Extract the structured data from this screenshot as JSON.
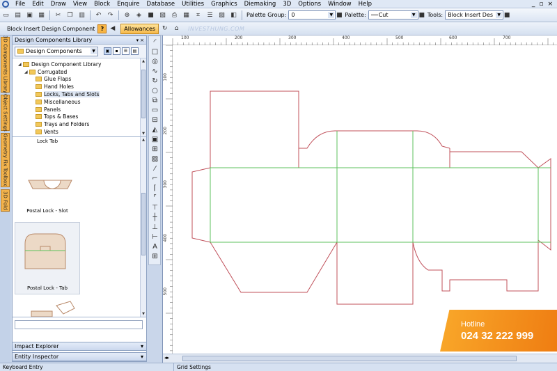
{
  "menu": [
    "File",
    "Edit",
    "Draw",
    "View",
    "Block",
    "Enquire",
    "Database",
    "Utilities",
    "Graphics",
    "Diemaking",
    "3D",
    "Options",
    "Window",
    "Help"
  ],
  "toolbar": {
    "palette_group_label": "Palette Group:",
    "palette_group_value": "0",
    "palette_label": "Palette:",
    "palette_value": "Cut",
    "tools_label": "Tools:",
    "tools_value": "Block Insert Des"
  },
  "toolbar2": {
    "command_label": "Block Insert Design Component",
    "help_label": "?",
    "allowances_label": "Allowances",
    "watermark": "INVESTHUNG.COM"
  },
  "left_tabs": [
    "3D Components Library",
    "Object Settings",
    "Geometry Fix Toolbox",
    "3D Fold"
  ],
  "library": {
    "title": "Design Components Library",
    "dropdown_value": "Design Components",
    "tree": {
      "root": "Design Component Library",
      "category": "Corrugated",
      "items": [
        "Glue Flaps",
        "Hand Holes",
        "Locks, Tabs and Slots",
        "Miscellaneous",
        "Panels",
        "Tops & Bases",
        "Trays and Folders",
        "Vents"
      ],
      "selected_index": 2
    },
    "previews": [
      {
        "caption": "Lock Tab"
      },
      {
        "caption": "Postal Lock - Slot"
      },
      {
        "caption": "Postal Lock - Tab"
      }
    ]
  },
  "panels": {
    "impact_explorer": "Impact Explorer",
    "entity_inspector": "Entity Inspector"
  },
  "ruler": {
    "h_labels": [
      "100",
      "200",
      "300",
      "400",
      "500",
      "600",
      "700"
    ],
    "v_labels": [
      "100",
      "200",
      "300",
      "400",
      "500"
    ]
  },
  "status": {
    "left": "Keyboard Entry",
    "right": "Grid Settings"
  },
  "hotline": {
    "title": "Hotline",
    "phone": "024 32 222 999"
  },
  "colors": {
    "cut_line": "#c0505a",
    "crease_line": "#5cc25c",
    "accent_orange": "#f39c1f"
  }
}
